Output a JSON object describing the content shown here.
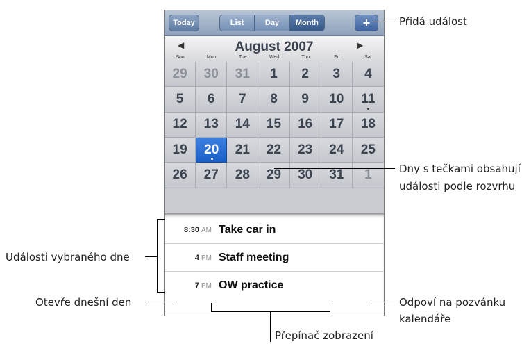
{
  "toolbar": {
    "today_label": "Today",
    "views": [
      {
        "label": "List"
      },
      {
        "label": "Day"
      },
      {
        "label": "Month",
        "selected": true
      }
    ],
    "add_label": "+"
  },
  "calendar": {
    "prev_arrow": "◀",
    "next_arrow": "▶",
    "month_title": "August 2007",
    "weekdays": [
      "Sun",
      "Mon",
      "Tue",
      "Wed",
      "Thu",
      "Fri",
      "Sat"
    ],
    "days": [
      {
        "d": "29",
        "muted": true
      },
      {
        "d": "30",
        "muted": true
      },
      {
        "d": "31",
        "muted": true
      },
      {
        "d": "1"
      },
      {
        "d": "2"
      },
      {
        "d": "3"
      },
      {
        "d": "4"
      },
      {
        "d": "5"
      },
      {
        "d": "6"
      },
      {
        "d": "7"
      },
      {
        "d": "8"
      },
      {
        "d": "9"
      },
      {
        "d": "10"
      },
      {
        "d": "11",
        "dot": true
      },
      {
        "d": "12"
      },
      {
        "d": "13"
      },
      {
        "d": "14"
      },
      {
        "d": "15"
      },
      {
        "d": "16"
      },
      {
        "d": "17"
      },
      {
        "d": "18"
      },
      {
        "d": "19"
      },
      {
        "d": "20",
        "today": true,
        "dot": true
      },
      {
        "d": "21"
      },
      {
        "d": "22"
      },
      {
        "d": "23"
      },
      {
        "d": "24"
      },
      {
        "d": "25"
      },
      {
        "d": "26"
      },
      {
        "d": "27"
      },
      {
        "d": "28"
      },
      {
        "d": "29"
      },
      {
        "d": "30"
      },
      {
        "d": "31"
      },
      {
        "d": "1",
        "muted": true
      }
    ]
  },
  "events": [
    {
      "time": "8:30",
      "ampm": "AM",
      "title": "Take car in"
    },
    {
      "time": "4",
      "ampm": "PM",
      "title": "Staff meeting"
    },
    {
      "time": "7",
      "ampm": "PM",
      "title": "OW practice"
    }
  ],
  "callouts": {
    "add_event": "Přidá událost",
    "dots_line1": "Dny s tečkami obsahují",
    "dots_line2": "události podle rozvrhu",
    "selected_day_events": "Události vybraného dne",
    "open_today": "Otevře dnešní den",
    "reply_line1": "Odpoví na pozvánku",
    "reply_line2": "kalendáře",
    "view_switch": "Přepínač zobrazení"
  },
  "colors": {
    "toolbar": "#8fa2bb",
    "selected_day": "#1a5fc8"
  }
}
